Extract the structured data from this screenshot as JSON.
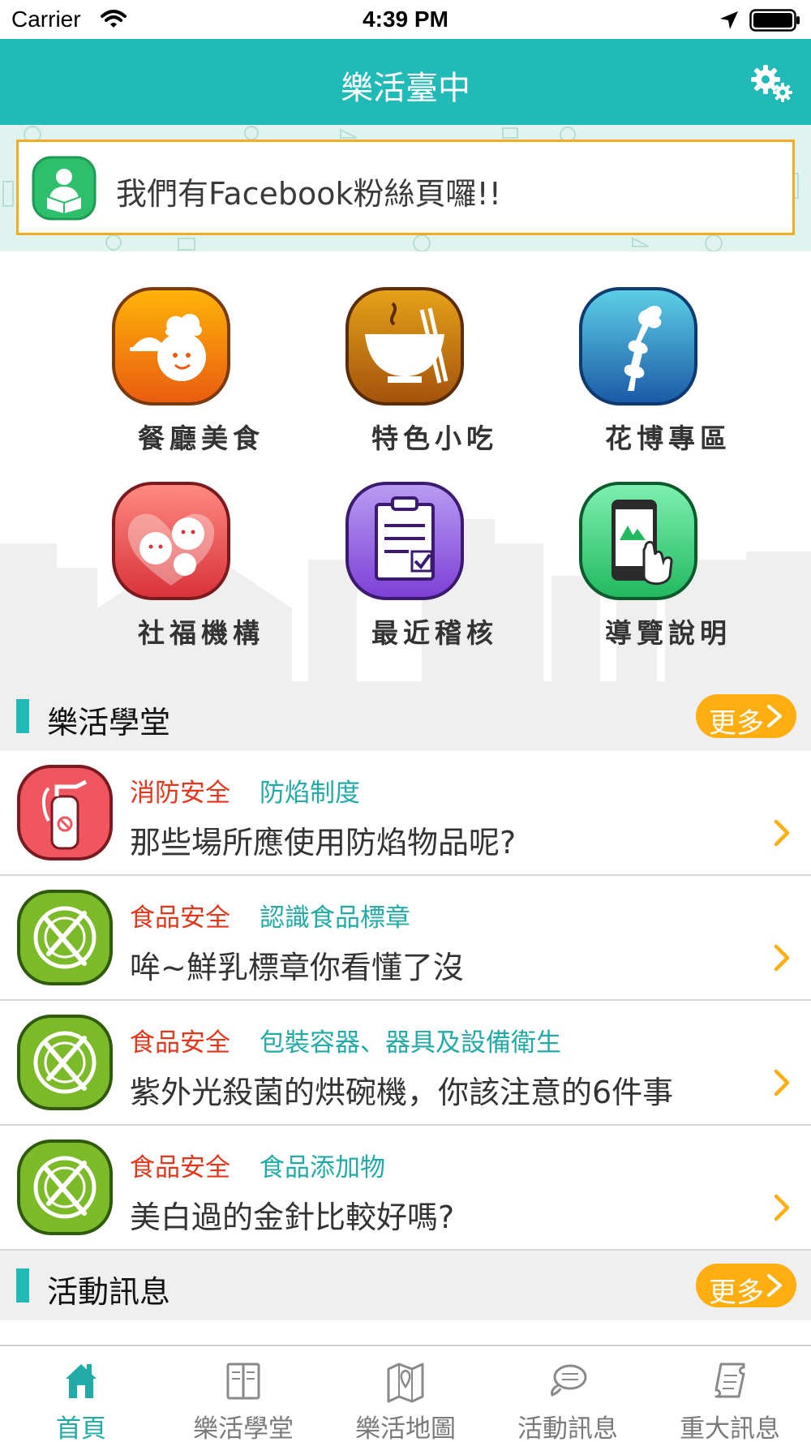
{
  "status_bar": {
    "carrier": "Carrier",
    "time": "4:39 PM"
  },
  "header": {
    "title": "樂活臺中",
    "settings_icon": "gear-icon"
  },
  "banner": {
    "text": "我們有Facebook粉絲頁囉!!",
    "icon": "reading-person-icon"
  },
  "categories": [
    {
      "label": "餐廳美食",
      "icon": "restaurant-chef-icon"
    },
    {
      "label": "特色小吃",
      "icon": "noodle-bowl-icon"
    },
    {
      "label": "花博專區",
      "icon": "flower-expo-icon"
    },
    {
      "label": "社福機構",
      "icon": "family-heart-icon"
    },
    {
      "label": "最近稽核",
      "icon": "clipboard-check-icon"
    },
    {
      "label": "導覽說明",
      "icon": "phone-guide-icon"
    }
  ],
  "lohas_school": {
    "title": "樂活學堂",
    "more_label": "更多",
    "items": [
      {
        "category": "消防安全",
        "subcategory": "防焰制度",
        "title": "那些場所應使用防焰物品呢?",
        "icon": "fire-extinguisher-icon"
      },
      {
        "category": "食品安全",
        "subcategory": "認識食品標章",
        "title": "哞~鮮乳標章你看懂了沒",
        "icon": "plate-cutlery-icon"
      },
      {
        "category": "食品安全",
        "subcategory": "包裝容器、器具及設備衛生",
        "title": "紫外光殺菌的烘碗機，你該注意的6件事",
        "icon": "plate-cutlery-icon"
      },
      {
        "category": "食品安全",
        "subcategory": "食品添加物",
        "title": "美白過的金針比較好嗎?",
        "icon": "plate-cutlery-icon"
      }
    ]
  },
  "events": {
    "title": "活動訊息",
    "more_label": "更多"
  },
  "tabbar": {
    "tabs": [
      {
        "label": "首頁",
        "icon": "home-icon",
        "active": true
      },
      {
        "label": "樂活學堂",
        "icon": "book-icon",
        "active": false
      },
      {
        "label": "樂活地圖",
        "icon": "map-pin-icon",
        "active": false
      },
      {
        "label": "活動訊息",
        "icon": "chat-bubble-icon",
        "active": false
      },
      {
        "label": "重大訊息",
        "icon": "scroll-icon",
        "active": false
      }
    ]
  },
  "colors": {
    "accent": "#22bab6",
    "more_button": "#ffae12",
    "category_red": "#e3361b",
    "subcategory_teal": "#22aaa6",
    "banner_border": "#f2ad1e"
  }
}
